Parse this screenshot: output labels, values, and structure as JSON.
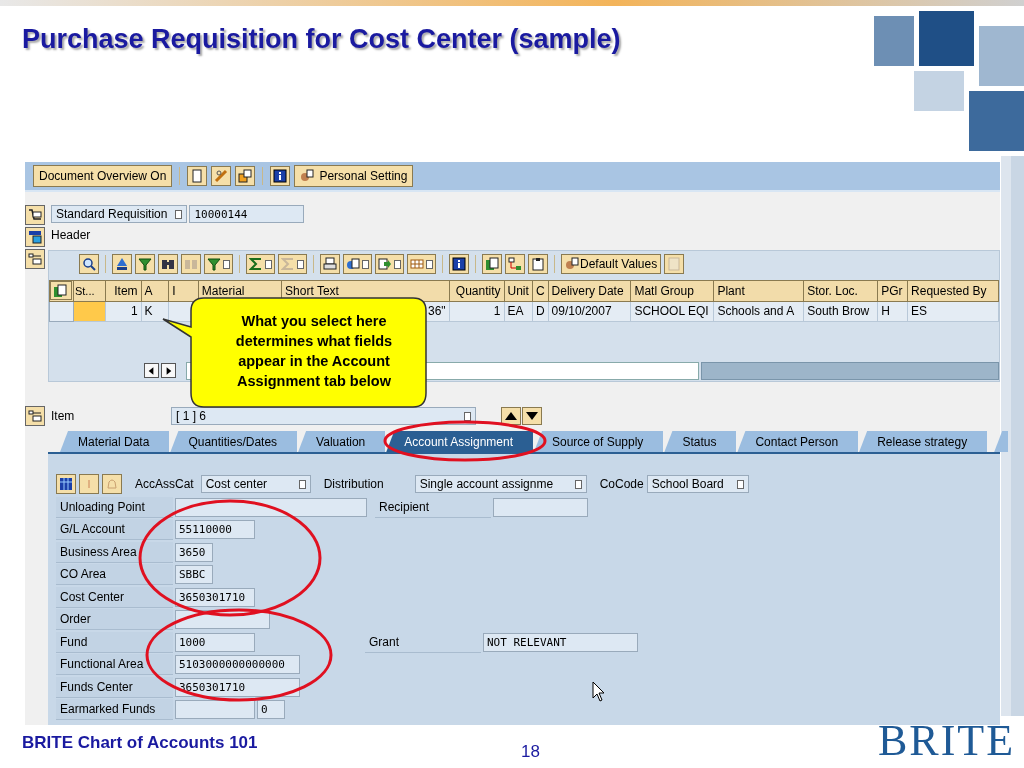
{
  "slide": {
    "title": "Purchase Requisition for Cost Center (sample)",
    "footer": "BRITE Chart of Accounts 101",
    "page_number": "18",
    "logo": "BRITE"
  },
  "toolbar": {
    "overview_button": "Document Overview On",
    "personal_button": "Personal Setting"
  },
  "document": {
    "type": "Standard Requisition",
    "number": "10000144",
    "header_label": "Header"
  },
  "items_toolbar": {
    "default_values_button": "Default Values"
  },
  "table": {
    "columns": [
      "St...",
      "Item",
      "A",
      "I",
      "Material",
      "Short Text",
      "Quantity",
      "Unit",
      "C",
      "Delivery Date",
      "Matl Group",
      "Plant",
      "Stor. Loc.",
      "PGr",
      "Requested By"
    ],
    "rows": [
      {
        "cells": [
          "",
          "1",
          "K",
          "",
          "",
          "36\"",
          "1",
          "EA",
          "D",
          "09/10/2007",
          "SCHOOL EQI",
          "Schools and A",
          "South Brow",
          "H",
          "ES"
        ]
      }
    ]
  },
  "item_selector": {
    "label": "Item",
    "value": "[ 1 ] 6"
  },
  "tabs": [
    {
      "label": "Material Data",
      "selected": false
    },
    {
      "label": "Quantities/Dates",
      "selected": false
    },
    {
      "label": "Valuation",
      "selected": false
    },
    {
      "label": "Account Assignment",
      "selected": true
    },
    {
      "label": "Source of Supply",
      "selected": false
    },
    {
      "label": "Status",
      "selected": false
    },
    {
      "label": "Contact Person",
      "selected": false
    },
    {
      "label": "Release strategy",
      "selected": false
    }
  ],
  "account_assignment": {
    "category_label": "AccAssCat",
    "category": "Cost center",
    "distribution_label": "Distribution",
    "distribution": "Single account assignme",
    "company_code_label": "CoCode",
    "company_code": "School Board",
    "fields": [
      {
        "label": "Unloading Point",
        "side": {
          "label": "Recipient"
        }
      },
      {
        "label": "G/L Account",
        "value": "55110000"
      },
      {
        "label": "Business Area",
        "value": "3650"
      },
      {
        "label": "CO Area",
        "value": "SBBC"
      },
      {
        "label": "Cost Center",
        "value": "3650301710"
      },
      {
        "label": "Order"
      },
      {
        "label": "Fund",
        "value": "1000",
        "side": {
          "label": "Grant",
          "value": "NOT RELEVANT"
        }
      },
      {
        "label": "Functional Area",
        "value": "5103000000000000"
      },
      {
        "label": "Funds Center",
        "value": "3650301710"
      },
      {
        "label": "Earmarked Funds",
        "extra": "0"
      }
    ]
  },
  "callout": "What you select here determines what fields appear in the Account Assignment tab below"
}
